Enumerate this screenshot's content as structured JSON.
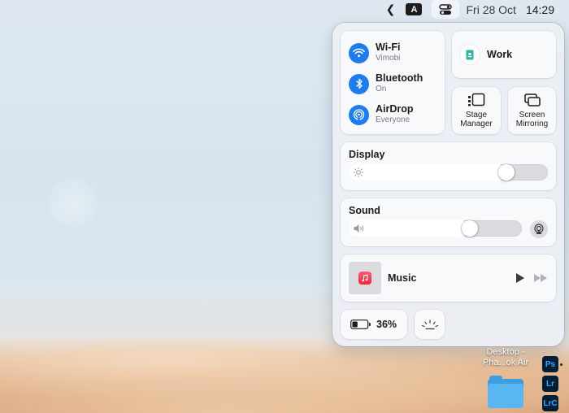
{
  "menubar": {
    "chevron": "❮",
    "input_source": "A",
    "date": "Fri 28 Oct",
    "time": "14:29"
  },
  "control_center": {
    "network": {
      "wifi": {
        "title": "Wi-Fi",
        "subtitle": "Vimobi"
      },
      "bluetooth": {
        "title": "Bluetooth",
        "subtitle": "On"
      },
      "airdrop": {
        "title": "AirDrop",
        "subtitle": "Everyone"
      }
    },
    "focus": {
      "label": "Work"
    },
    "stage_manager": {
      "line1": "Stage",
      "line2": "Manager"
    },
    "screen_mirroring": {
      "line1": "Screen",
      "line2": "Mirroring"
    },
    "display": {
      "title": "Display",
      "level": 0.79
    },
    "sound": {
      "title": "Sound",
      "level": 0.7
    },
    "now_playing": {
      "label": "Music"
    },
    "battery": {
      "label": "36%",
      "level": 0.36
    }
  },
  "desktop": {
    "item_line1": "Desktop -",
    "item_line2": "Pha...ok Air",
    "dock_ps": "Ps",
    "dock_lr": "Lr",
    "dock_lrc": "LrC"
  },
  "colors": {
    "accent_blue": "#1d7cf2",
    "music_red": "#fa233b"
  },
  "icons": [
    "wifi-icon",
    "bluetooth-icon",
    "airdrop-icon",
    "focus-work-icon",
    "stage-manager-icon",
    "screen-mirroring-icon",
    "sun-icon",
    "speaker-icon",
    "airplay-icon",
    "music-app-icon",
    "play-icon",
    "fast-forward-icon",
    "battery-icon",
    "keyboard-brightness-icon"
  ]
}
